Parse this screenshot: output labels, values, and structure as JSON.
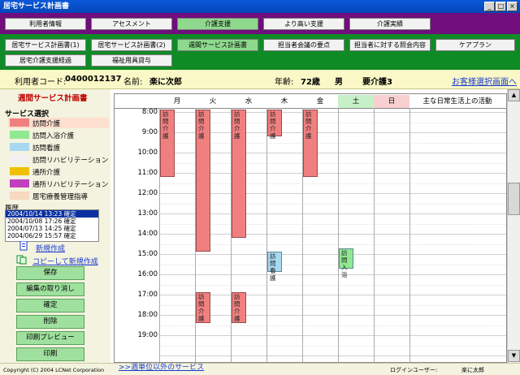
{
  "window": {
    "title": "居宅サービス計画書"
  },
  "nav_primary": [
    "利用者情報",
    "アセスメント",
    "介護支援",
    "より高い支援",
    "介護実績"
  ],
  "nav_secondary_row1": [
    "居宅サービス計画書(1)",
    "居宅サービス計画書(2)",
    "週間サービス計画書",
    "担当者会議の要点",
    "担当者に対する照会内容",
    "ケアプラン"
  ],
  "nav_secondary_row2": [
    "居宅介護支援経過",
    "福祉用具貸与"
  ],
  "patient": {
    "code_label": "利用者コード:",
    "code": "0400012137",
    "name_label": "名前:",
    "name": "楽に次郎",
    "age_label": "年齢:",
    "age": "72歳",
    "sex": "男",
    "care_level": "要介護3",
    "select_link": "お客様選択画面へ"
  },
  "left": {
    "section_title": "週間サービス計画書",
    "service_title": "サービス選択",
    "services": [
      {
        "label": "訪問介護",
        "color": "#f08080"
      },
      {
        "label": "訪問入浴介護",
        "color": "#90e890"
      },
      {
        "label": "訪問看護",
        "color": "#a8d8f0"
      },
      {
        "label": "訪問リハビリテーション",
        "color": "#f0f0f0"
      },
      {
        "label": "通所介護",
        "color": "#f0c000"
      },
      {
        "label": "通所リハビリテーション",
        "color": "#c040c0"
      },
      {
        "label": "居宅療養管理指導",
        "color": "#f8d8c0"
      }
    ],
    "history_title": "履歴",
    "history": [
      "2004/10/14 13:23 確定",
      "2004/10/08 17:26 確定",
      "2004/07/13 14:25 確定",
      "2004/06/29 15:57 確定"
    ],
    "new_link": "新規作成",
    "copy_link": "コピーして新規作成",
    "buttons": [
      "保存",
      "編集の取り消し",
      "確定",
      "削除",
      "印刷プレビュー",
      "印刷"
    ]
  },
  "schedule": {
    "days": [
      "月",
      "火",
      "水",
      "木",
      "金",
      "土",
      "日"
    ],
    "activity_header": "主な日常生活上の活動",
    "hours": [
      "8:00",
      "9:00",
      "10:00",
      "11:00",
      "12:00",
      "13:00",
      "14:00",
      "15:00",
      "16:00",
      "17:00",
      "18:00",
      "19:00"
    ],
    "appointments": [
      {
        "day": 0,
        "start": 8.0,
        "end": 11.33,
        "label": "訪問介護",
        "type": "visit"
      },
      {
        "day": 1,
        "start": 8.0,
        "end": 15.0,
        "label": "訪問介護",
        "type": "visit"
      },
      {
        "day": 1,
        "start": 17.0,
        "end": 18.5,
        "label": "訪問介護",
        "type": "visit"
      },
      {
        "day": 2,
        "start": 8.0,
        "end": 14.33,
        "label": "訪問介護",
        "type": "visit"
      },
      {
        "day": 2,
        "start": 17.0,
        "end": 18.5,
        "label": "訪問介護",
        "type": "visit"
      },
      {
        "day": 3,
        "start": 8.0,
        "end": 9.33,
        "label": "訪問介護",
        "type": "visit"
      },
      {
        "day": 3,
        "start": 15.0,
        "end": 16.0,
        "label": "訪問看護",
        "type": "nurse"
      },
      {
        "day": 4,
        "start": 8.0,
        "end": 11.33,
        "label": "訪問介護",
        "type": "visit"
      },
      {
        "day": 5,
        "start": 14.83,
        "end": 15.83,
        "label": "訪問入浴",
        "type": "bath"
      }
    ],
    "footer_link": ">>週単位以外のサービス"
  },
  "footer": {
    "copyright": "Copyright (C) 2004 LCNet Corporation",
    "login_label": "ログインユーザー:",
    "login_user": "楽に太郎"
  },
  "colors": {
    "visit": "#f08080",
    "nurse": "#a8d8f0",
    "bath": "#90e890"
  }
}
